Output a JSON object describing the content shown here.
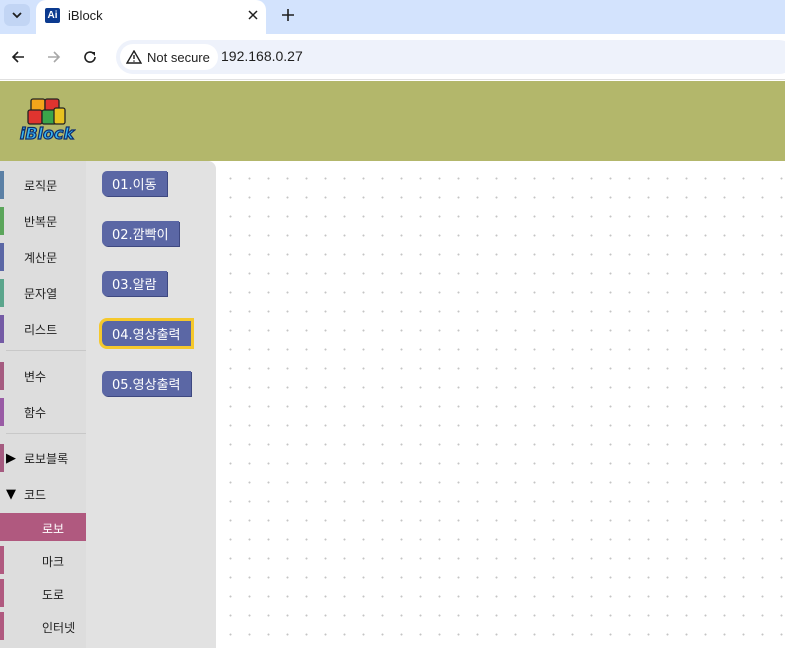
{
  "browser": {
    "tab": {
      "title": "iBlock",
      "favicon": "Ai"
    },
    "security_label": "Not secure",
    "url": "192.168.0.27"
  },
  "app": {
    "logo_text": "iBlock",
    "header_color": "#b3b76b"
  },
  "sidebar": {
    "categories": [
      {
        "label": "로직문",
        "color": "#5b80a5"
      },
      {
        "label": "반복문",
        "color": "#5ba55b"
      },
      {
        "label": "계산문",
        "color": "#5b67a5"
      },
      {
        "label": "문자열",
        "color": "#5ba58c"
      },
      {
        "label": "리스트",
        "color": "#745ba5"
      },
      {
        "label": "변수",
        "color": "#a55b80"
      },
      {
        "label": "함수",
        "color": "#995ba5"
      }
    ],
    "groups": [
      {
        "label": "로보블록",
        "expanded": false,
        "arrow": "▶"
      },
      {
        "label": "코드",
        "expanded": true,
        "arrow": "▼"
      }
    ],
    "subcategories": [
      {
        "label": "로보",
        "selected": true
      },
      {
        "label": "마크",
        "selected": false
      },
      {
        "label": "도로",
        "selected": false
      },
      {
        "label": "인터넷",
        "selected": false
      }
    ]
  },
  "flyout": {
    "blocks": [
      {
        "label": "01.이동",
        "selected": false
      },
      {
        "label": "02.깜빡이",
        "selected": false
      },
      {
        "label": "03.알람",
        "selected": false
      },
      {
        "label": "04.영상출력",
        "selected": true
      },
      {
        "label": "05.영상출력",
        "selected": false
      }
    ],
    "block_color": "#5b67a5",
    "highlight_color": "#f5c82c"
  }
}
